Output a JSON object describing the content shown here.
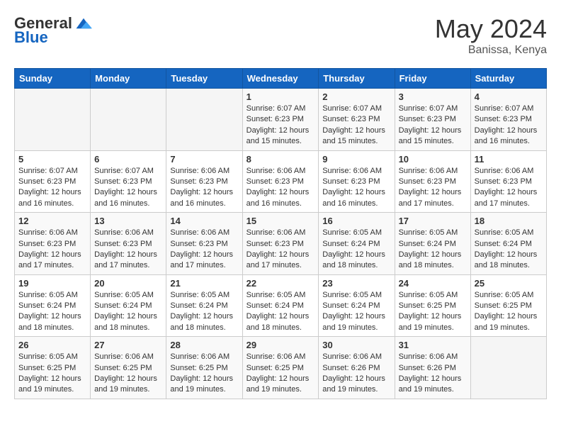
{
  "logo": {
    "general": "General",
    "blue": "Blue"
  },
  "title": {
    "month_year": "May 2024",
    "location": "Banissa, Kenya"
  },
  "weekdays": [
    "Sunday",
    "Monday",
    "Tuesday",
    "Wednesday",
    "Thursday",
    "Friday",
    "Saturday"
  ],
  "weeks": [
    [
      {
        "day": "",
        "info": ""
      },
      {
        "day": "",
        "info": ""
      },
      {
        "day": "",
        "info": ""
      },
      {
        "day": "1",
        "info": "Sunrise: 6:07 AM\nSunset: 6:23 PM\nDaylight: 12 hours\nand 15 minutes."
      },
      {
        "day": "2",
        "info": "Sunrise: 6:07 AM\nSunset: 6:23 PM\nDaylight: 12 hours\nand 15 minutes."
      },
      {
        "day": "3",
        "info": "Sunrise: 6:07 AM\nSunset: 6:23 PM\nDaylight: 12 hours\nand 15 minutes."
      },
      {
        "day": "4",
        "info": "Sunrise: 6:07 AM\nSunset: 6:23 PM\nDaylight: 12 hours\nand 16 minutes."
      }
    ],
    [
      {
        "day": "5",
        "info": "Sunrise: 6:07 AM\nSunset: 6:23 PM\nDaylight: 12 hours\nand 16 minutes."
      },
      {
        "day": "6",
        "info": "Sunrise: 6:07 AM\nSunset: 6:23 PM\nDaylight: 12 hours\nand 16 minutes."
      },
      {
        "day": "7",
        "info": "Sunrise: 6:06 AM\nSunset: 6:23 PM\nDaylight: 12 hours\nand 16 minutes."
      },
      {
        "day": "8",
        "info": "Sunrise: 6:06 AM\nSunset: 6:23 PM\nDaylight: 12 hours\nand 16 minutes."
      },
      {
        "day": "9",
        "info": "Sunrise: 6:06 AM\nSunset: 6:23 PM\nDaylight: 12 hours\nand 16 minutes."
      },
      {
        "day": "10",
        "info": "Sunrise: 6:06 AM\nSunset: 6:23 PM\nDaylight: 12 hours\nand 17 minutes."
      },
      {
        "day": "11",
        "info": "Sunrise: 6:06 AM\nSunset: 6:23 PM\nDaylight: 12 hours\nand 17 minutes."
      }
    ],
    [
      {
        "day": "12",
        "info": "Sunrise: 6:06 AM\nSunset: 6:23 PM\nDaylight: 12 hours\nand 17 minutes."
      },
      {
        "day": "13",
        "info": "Sunrise: 6:06 AM\nSunset: 6:23 PM\nDaylight: 12 hours\nand 17 minutes."
      },
      {
        "day": "14",
        "info": "Sunrise: 6:06 AM\nSunset: 6:23 PM\nDaylight: 12 hours\nand 17 minutes."
      },
      {
        "day": "15",
        "info": "Sunrise: 6:06 AM\nSunset: 6:23 PM\nDaylight: 12 hours\nand 17 minutes."
      },
      {
        "day": "16",
        "info": "Sunrise: 6:05 AM\nSunset: 6:24 PM\nDaylight: 12 hours\nand 18 minutes."
      },
      {
        "day": "17",
        "info": "Sunrise: 6:05 AM\nSunset: 6:24 PM\nDaylight: 12 hours\nand 18 minutes."
      },
      {
        "day": "18",
        "info": "Sunrise: 6:05 AM\nSunset: 6:24 PM\nDaylight: 12 hours\nand 18 minutes."
      }
    ],
    [
      {
        "day": "19",
        "info": "Sunrise: 6:05 AM\nSunset: 6:24 PM\nDaylight: 12 hours\nand 18 minutes."
      },
      {
        "day": "20",
        "info": "Sunrise: 6:05 AM\nSunset: 6:24 PM\nDaylight: 12 hours\nand 18 minutes."
      },
      {
        "day": "21",
        "info": "Sunrise: 6:05 AM\nSunset: 6:24 PM\nDaylight: 12 hours\nand 18 minutes."
      },
      {
        "day": "22",
        "info": "Sunrise: 6:05 AM\nSunset: 6:24 PM\nDaylight: 12 hours\nand 18 minutes."
      },
      {
        "day": "23",
        "info": "Sunrise: 6:05 AM\nSunset: 6:24 PM\nDaylight: 12 hours\nand 19 minutes."
      },
      {
        "day": "24",
        "info": "Sunrise: 6:05 AM\nSunset: 6:25 PM\nDaylight: 12 hours\nand 19 minutes."
      },
      {
        "day": "25",
        "info": "Sunrise: 6:05 AM\nSunset: 6:25 PM\nDaylight: 12 hours\nand 19 minutes."
      }
    ],
    [
      {
        "day": "26",
        "info": "Sunrise: 6:05 AM\nSunset: 6:25 PM\nDaylight: 12 hours\nand 19 minutes."
      },
      {
        "day": "27",
        "info": "Sunrise: 6:06 AM\nSunset: 6:25 PM\nDaylight: 12 hours\nand 19 minutes."
      },
      {
        "day": "28",
        "info": "Sunrise: 6:06 AM\nSunset: 6:25 PM\nDaylight: 12 hours\nand 19 minutes."
      },
      {
        "day": "29",
        "info": "Sunrise: 6:06 AM\nSunset: 6:25 PM\nDaylight: 12 hours\nand 19 minutes."
      },
      {
        "day": "30",
        "info": "Sunrise: 6:06 AM\nSunset: 6:26 PM\nDaylight: 12 hours\nand 19 minutes."
      },
      {
        "day": "31",
        "info": "Sunrise: 6:06 AM\nSunset: 6:26 PM\nDaylight: 12 hours\nand 19 minutes."
      },
      {
        "day": "",
        "info": ""
      }
    ]
  ]
}
